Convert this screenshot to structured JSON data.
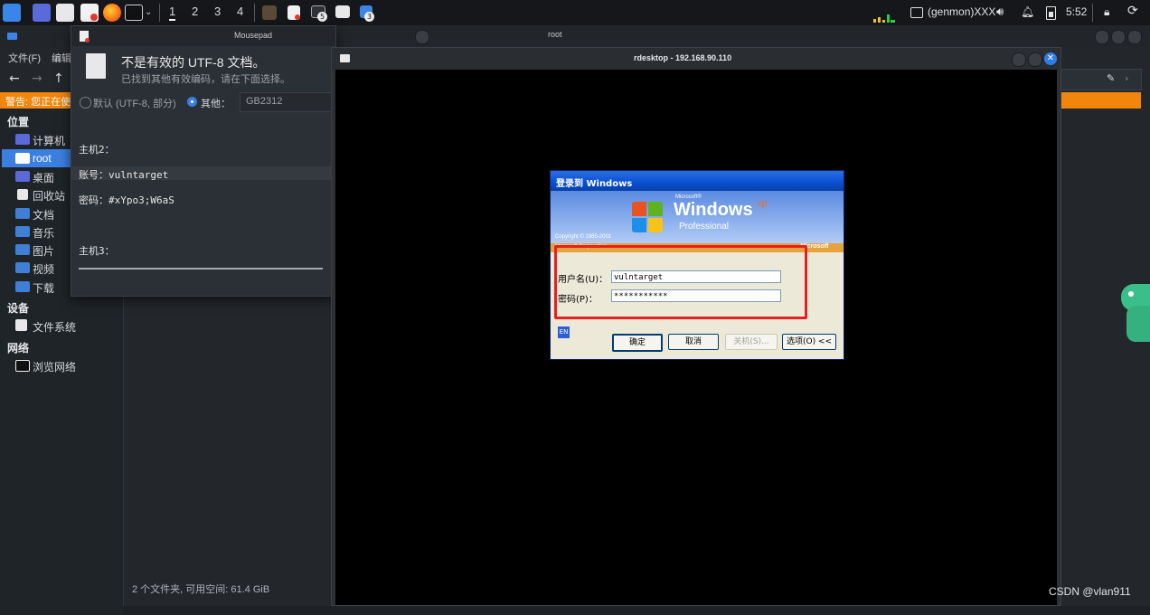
{
  "taskbar": {
    "workspaces": [
      "1",
      "2",
      "3",
      "4"
    ],
    "genmon": "(genmon)XXX",
    "clock": "5:52",
    "badge_a": "5",
    "badge_b": "3"
  },
  "file_manager": {
    "title": "root",
    "menu_file": "文件(F)",
    "menu_edit": "编辑",
    "warning": "警告: 您正在使",
    "places_head": "位置",
    "places": [
      "计算机",
      "root",
      "桌面",
      "回收站",
      "文档",
      "音乐",
      "图片",
      "视频",
      "下载"
    ],
    "devices_head": "设备",
    "devices": [
      "文件系统"
    ],
    "network_head": "网络",
    "network": [
      "浏览网络"
    ],
    "status": "2 个文件夹, 可用空间: 61.4 GiB"
  },
  "mousepad": {
    "title": "Mousepad",
    "notice_title": "不是有效的 UTF-8 文档。",
    "notice_sub": "已找到其他有效编码，请在下面选择。",
    "opt_default": "默认 (UTF-8, 部分)",
    "opt_other": "其他：",
    "encoding": "GB2312",
    "lines": [
      "主机2：",
      "账号：vulntarget",
      "密码：#xYpo3;W6aS",
      "主机3："
    ]
  },
  "rdesktop": {
    "title": "rdesktop - 192.168.90.110"
  },
  "xp_login": {
    "title": "登录到 Windows",
    "brand_small": "Microsoft®",
    "brand": "Windows",
    "brand_xp": "xp",
    "edition": "Professional",
    "copyright": "Copyright © 1985-2001",
    "corp": "Microsoft Corporation",
    "ms_logo": "Microsoft",
    "username_label": "用户名(U)：",
    "username_value": "vulntarget",
    "password_label": "密码(P)：",
    "password_value": "***********",
    "lang": "EN",
    "ok": "确定",
    "cancel": "取消",
    "shutdown": "关机(S)...",
    "options": "选项(O) <<"
  },
  "watermark": "CSDN @vlan911"
}
